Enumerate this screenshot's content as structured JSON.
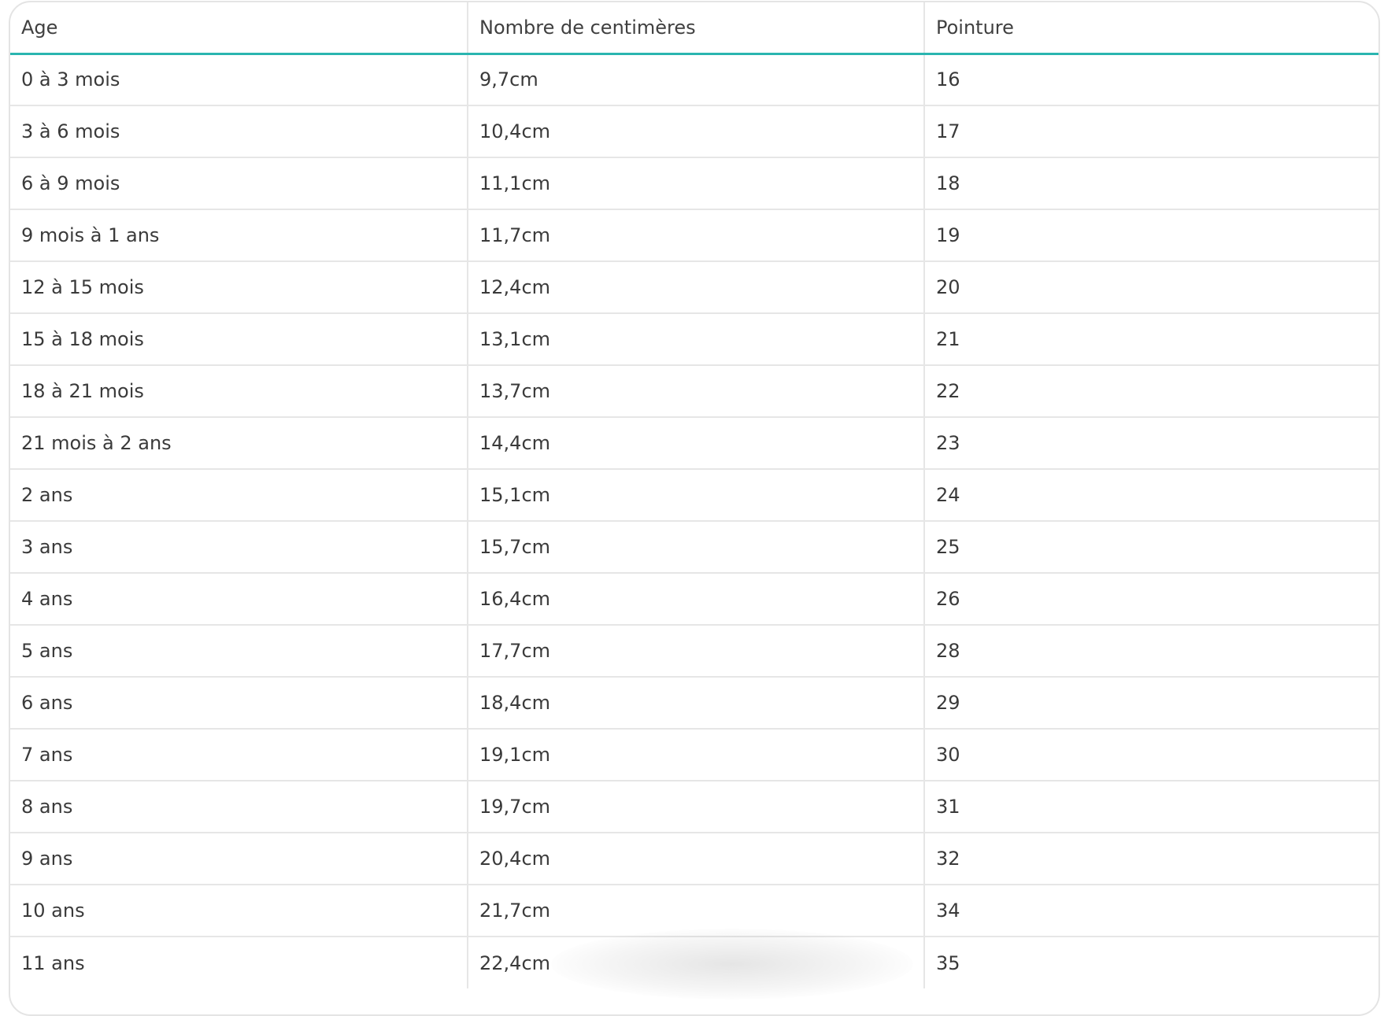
{
  "table": {
    "headers": [
      "Age",
      "Nombre de centimères",
      "Pointure"
    ],
    "rows": [
      [
        "0 à 3 mois",
        "9,7cm",
        "16"
      ],
      [
        "3 à 6 mois",
        "10,4cm",
        "17"
      ],
      [
        "6 à 9 mois",
        "11,1cm",
        "18"
      ],
      [
        "9 mois à 1 ans",
        "11,7cm",
        "19"
      ],
      [
        "12 à 15 mois",
        "12,4cm",
        "20"
      ],
      [
        "15 à 18 mois",
        "13,1cm",
        "21"
      ],
      [
        "18 à 21 mois",
        "13,7cm",
        "22"
      ],
      [
        "21 mois à 2 ans",
        "14,4cm",
        "23"
      ],
      [
        "2 ans",
        "15,1cm",
        "24"
      ],
      [
        "3 ans",
        "15,7cm",
        "25"
      ],
      [
        "4 ans",
        "16,4cm",
        "26"
      ],
      [
        "5 ans",
        "17,7cm",
        "28"
      ],
      [
        "6 ans",
        "18,4cm",
        "29"
      ],
      [
        "7 ans",
        "19,1cm",
        "30"
      ],
      [
        "8 ans",
        "19,7cm",
        "31"
      ],
      [
        "9 ans",
        "20,4cm",
        "32"
      ],
      [
        "10 ans",
        "21,7cm",
        "34"
      ],
      [
        "11 ans",
        "22,4cm",
        "35"
      ]
    ]
  },
  "colors": {
    "header_underline": "#2ab5b0",
    "grid_line": "#e6e6e6",
    "text": "#3a3a3a"
  }
}
